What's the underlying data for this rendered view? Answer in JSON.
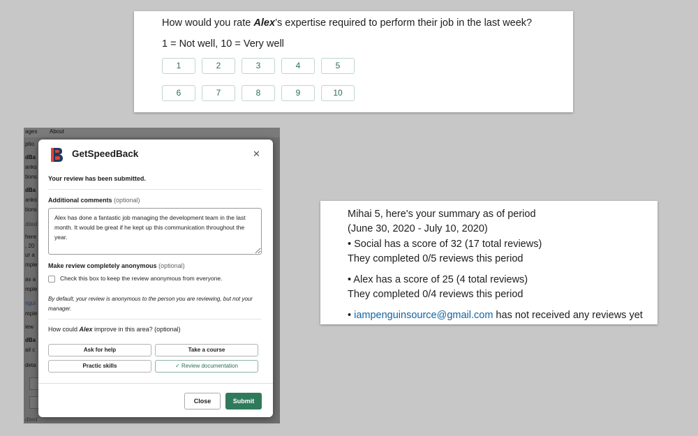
{
  "rating": {
    "question_pre": "How would you rate ",
    "question_name": "Alex",
    "question_post": "’s expertise required to perform their job in the last week?",
    "scale_text": "1 = Not well, 10 = Very well",
    "options": [
      "1",
      "2",
      "3",
      "4",
      "5",
      "6",
      "7",
      "8",
      "9",
      "10"
    ]
  },
  "summary": {
    "line1": "Mihai 5, here's your summary as of period",
    "line2": "(June 30, 2020 - July 10, 2020)",
    "line3": "• Social has a score of 32 (17 total reviews)",
    "line4": "They completed 0/5 reviews this period",
    "line5": "• Alex has a score of 25 (4 total reviews)",
    "line6": "They completed 0/4 reviews this period",
    "line7_bullet": "• ",
    "line7_email": "iampenguinsource@gmail.com",
    "line7_rest": " has not received any reviews yet"
  },
  "background": {
    "header_left": "ages",
    "header_about": "About",
    "fragments": [
      "ptio",
      "dBa",
      "anks",
      "tions",
      "dBa",
      "anks",
      "tions",
      "dited",
      "here",
      ", 20",
      "ur a",
      "mple",
      "as a",
      "mple",
      "ngui",
      "mple",
      "iew",
      "dBa",
      "ail c",
      "deta",
      "dited"
    ]
  },
  "modal": {
    "app_name": "GetSpeedBack",
    "close_symbol": "✕",
    "submitted_text": "Your review has been submitted.",
    "comments_label": "Additional comments",
    "optional_paren": "(optional)",
    "comments_value": "Alex has done a fantastic job managing the development team in the last month. It would be great if he kept up this communication throughout the year.",
    "anon_label": "Make review completely anonymous",
    "anon_checkbox_text": "Check this box to keep the review anonymous from everyone.",
    "anon_checked": false,
    "note": "By default, your review is anonymous to the person you are reviewing, but not your manager.",
    "improve_pre": "How could ",
    "improve_name": "Alex",
    "improve_post": " improve in this area? (optional)",
    "suggestions": [
      {
        "label": "Ask for help",
        "selected": false
      },
      {
        "label": "Take a course",
        "selected": false
      },
      {
        "label": "Practic skills",
        "selected": false
      },
      {
        "label": "✓ Review documentation",
        "selected": true
      }
    ],
    "close_button": "Close",
    "submit_button": "Submit",
    "colors": {
      "accent": "#2f7a5b",
      "logo_red": "#e0423a",
      "logo_navy": "#1d3a5e"
    }
  }
}
